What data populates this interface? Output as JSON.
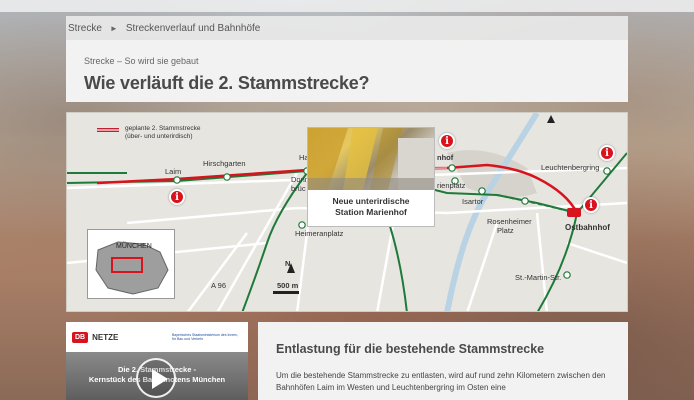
{
  "breadcrumb": {
    "items": [
      "Strecke",
      "Streckenverlauf und Bahnhöfe"
    ],
    "separator": "►"
  },
  "header": {
    "kicker": "Strecke – So wird sie gebaut",
    "title": "Wie verläuft die 2. Stammstrecke?"
  },
  "map": {
    "legend_label": "geplante 2. Stammstrecke (über- und unterirdisch)",
    "photo_caption_line1": "Neue unterirdische",
    "photo_caption_line2": "Station Marienhof",
    "inset_label": "MÜNCHEN",
    "scale_label": "500 m",
    "north_label": "N",
    "info_symbol": "i",
    "labels": {
      "laim": "Laim",
      "hirschgarten": "Hirschgarten",
      "donners1": "Donn",
      "donners2": "brüc",
      "ha": "Ha",
      "heimeranplatz": "Heimeranplatz",
      "a96": "A 96",
      "marienhof": "nhof",
      "marienplatz": "rienplatz",
      "isartor": "Isartor",
      "leuchtenbergring": "Leuchtenbergring",
      "rosenheimer1": "Rosenheimer",
      "rosenheimer2": "Platz",
      "ostbahnhof": "Ostbahnhof",
      "stmartin": "St.-Martin-Str."
    },
    "colors": {
      "new_line": "#d7141e",
      "sbahn": "#1f7a3a",
      "info": "#d7141e"
    }
  },
  "video": {
    "db_logo": "DB",
    "netze": "NETZE",
    "ministry": "Bayerisches Staatsministerium des Innern, für Bau und Verkehr",
    "title_line1": "Die 2. Stammstrecke -",
    "title_line2": "Kernstück des Bahnknotens München"
  },
  "content": {
    "heading": "Entlastung für die bestehende Stammstrecke",
    "body": "Um die bestehende Stammstrecke zu entlasten, wird auf rund zehn Kilometern zwischen den Bahnhöfen Laim im Westen und Leuchtenbergring im Osten eine"
  }
}
